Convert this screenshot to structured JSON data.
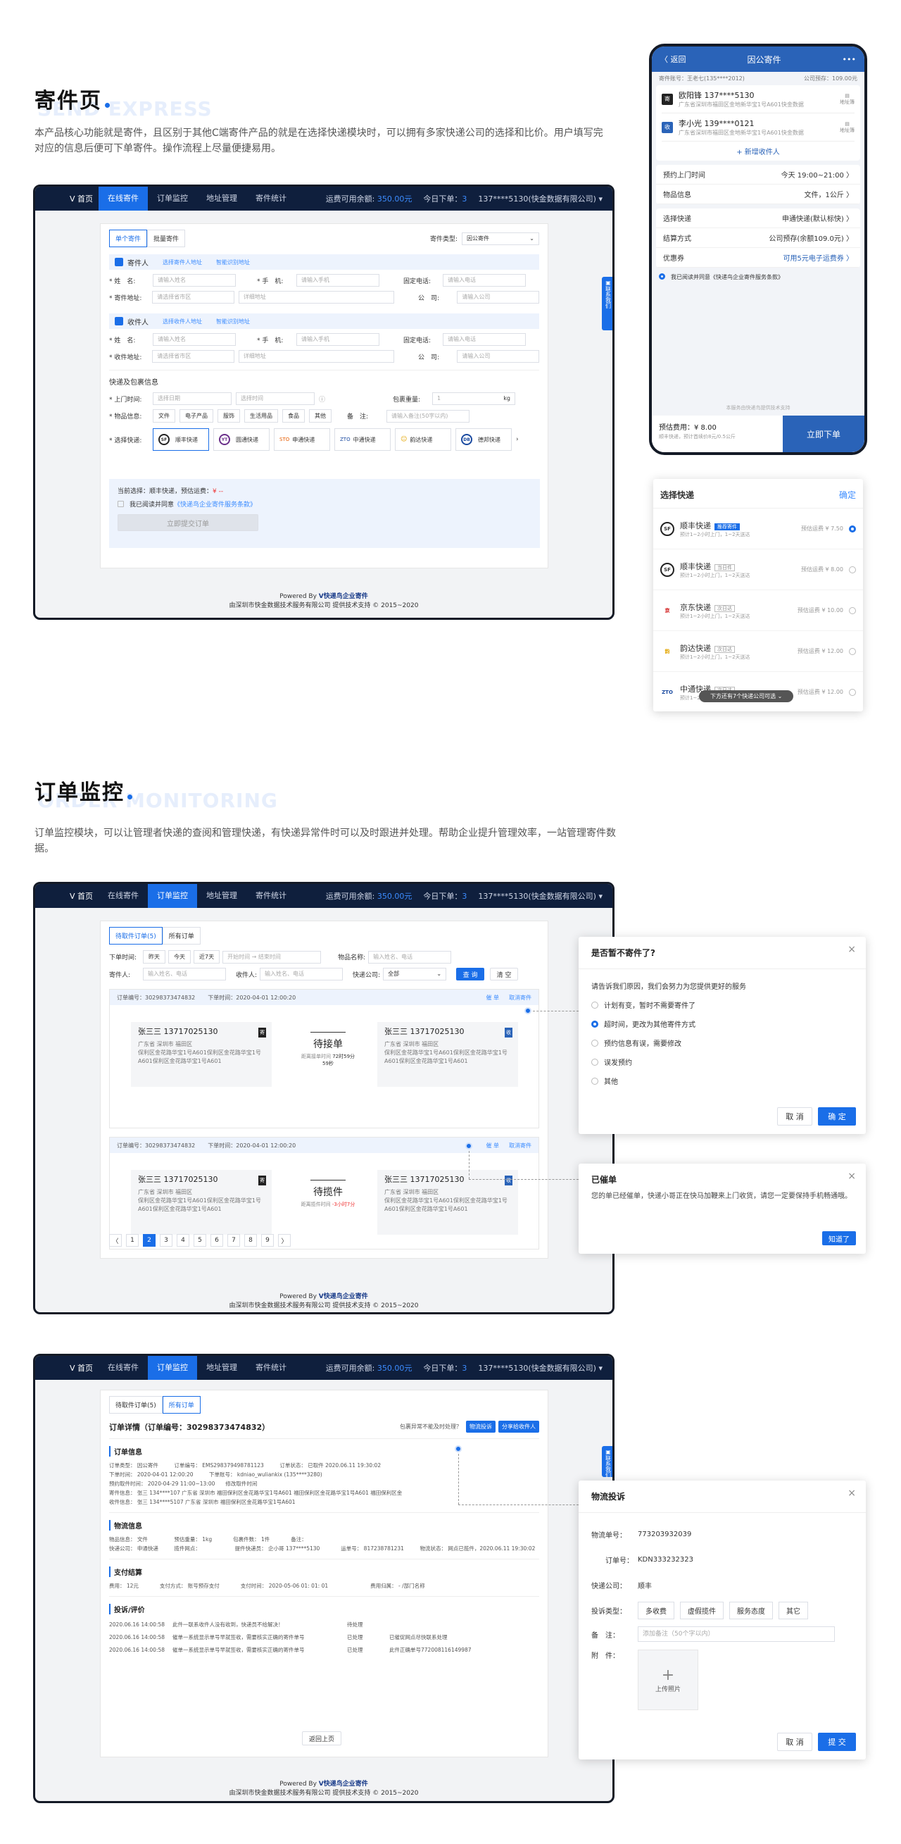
{
  "sec1": {
    "title": "寄件页",
    "en": "SEND EXPRESS",
    "desc": "本产品核心功能就是寄件，且区别于其他C端寄件产品的就是在选择快递模块时，可以拥有多家快递公司的选择和比价。用户填写完对应的信息后便可下单寄件。操作流程上尽量便捷易用。"
  },
  "sec2": {
    "title": "订单监控",
    "en": "ORDER MONITORING",
    "desc": "订单监控模块，可以让管理者快递的查阅和管理快递，有快递异常件时可以及时跟进并处理。帮助企业提升管理效率，一站管理寄件数据。"
  },
  "nav": {
    "logo": "首页",
    "items": [
      "在线寄件",
      "订单监控",
      "地址管理",
      "寄件统计"
    ],
    "balance_label": "运费可用余额:",
    "balance": "350.00元",
    "today_label": "今日下单：",
    "today": "3",
    "user": "137****5130(快金数据有限公司) ▾"
  },
  "footer": {
    "powered": "Powered By",
    "brand": "V快递鸟企业寄件",
    "copyright": "由深圳市快金数据技术服务有限公司 提供技术支持 © 2015~2020"
  },
  "send": {
    "tabs": [
      "单个寄件",
      "批量寄件"
    ],
    "type_label": "寄件类型:",
    "type_value": "因公寄件",
    "sender_title": "寄件人",
    "sender_link1": "选择寄件人地址",
    "sender_link2": "智能识别地址",
    "receiver_title": "收件人",
    "receiver_link1": "选择收件人地址",
    "receiver_link2": "智能识别地址",
    "name_label": "* 姓　名:",
    "name_ph": "请输入姓名",
    "phone_label": "* 手　机:",
    "phone_ph": "请输入手机",
    "tel_label": "固定电话:",
    "tel_ph": "请输入电话",
    "addr_label": "* 寄件地址:",
    "addr_ph": "请选择省市区",
    "addr_detail_ph": "详细地址",
    "company_label": "公　司:",
    "company_ph": "请输入公司",
    "recv_addr_label": "* 收件地址:",
    "pkg_title": "快递及包裹信息",
    "pickup_label": "* 上门时间:",
    "date_ph": "选择日期",
    "time_ph": "选择时间",
    "weight_label": "包裹重量:",
    "weight_val": "1",
    "weight_unit": "kg",
    "goods_label": "* 物品信息:",
    "goods": [
      "文件",
      "电子产品",
      "服饰",
      "生活用品",
      "食品",
      "其他"
    ],
    "remark_label": "备　注:",
    "remark_ph": "请输入备注(50字以内)",
    "express_label": "* 选择快递:",
    "express": [
      "顺丰快递",
      "圆通快递",
      "申通快递",
      "中通快递",
      "韵达快递",
      "德邦快递"
    ],
    "current": "当前选择：顺丰快递，预估运费：",
    "current_price": "¥ --",
    "agree": "我已阅读并同意",
    "agree_link": "《快递鸟企业寄件服务条款》",
    "submit": "立即提交订单",
    "contact": "联系我们"
  },
  "phone": {
    "back": "〈 返回",
    "title": "因公寄件",
    "more": "•••",
    "account": "寄件账号：王老七(135****2012)",
    "quota": "公司预存：109.00元",
    "sender_name": "欧阳锋 137****5130",
    "sender_addr": "广东省深圳市福田区金地新华宝1号A601快金数据",
    "receiver_name": "李小光 139****0121",
    "receiver_addr": "广东省深圳市福田区金地新华宝1号A601快金数据",
    "book": "地址簿",
    "add_receiver": "+ 新增收件人",
    "rows": [
      {
        "k": "预约上门时间",
        "v": "今天 19:00~21:00 〉"
      },
      {
        "k": "物品信息",
        "v": "文件，1公斤 〉"
      },
      {
        "k": "选择快递",
        "v": "申通快递(默认标快) 〉"
      },
      {
        "k": "结算方式",
        "v": "公司预存(余额109.0元) 〉"
      },
      {
        "k": "优惠券",
        "v": "可用5元电子运费券 〉"
      }
    ],
    "agree": "我已阅读并同意《快递鸟企业寄件服务条款》",
    "note": "本服务由快递鸟提供技术支持",
    "fee_label": "预估费用：¥ 8.00",
    "fee_note": "顺丰快递，预计首续价8元/0.5公斤",
    "order": "立即下单"
  },
  "select": {
    "title": "选择快递",
    "confirm": "确定",
    "items": [
      {
        "logo": "SF",
        "name": "顺丰快递",
        "tag": "推荐寄件",
        "sub": "预计1~2小时上门，1~2天送达",
        "price": "预估运费 ¥ 7.50"
      },
      {
        "logo": "SF",
        "name": "顺丰快递",
        "tag": "当日件",
        "sub": "预计1~2小时上门，1~2天送达",
        "price": "预估运费 ¥ 8.00"
      },
      {
        "logo": "京",
        "name": "京东快递",
        "tag": "次日达",
        "sub": "预计1~2小时上门，1~2天送达",
        "price": "预估运费 ¥ 10.00"
      },
      {
        "logo": "韵",
        "name": "韵达快递",
        "tag": "次日达",
        "sub": "预计1~2小时上门，1~2天送达",
        "price": "预估运费 ¥ 12.00"
      },
      {
        "logo": "ZTO",
        "name": "中通快递",
        "tag": "次日达",
        "sub": "预计1~2小时上门，1~2天送达",
        "price": "预估运费 ¥ 12.00"
      }
    ],
    "more": "下方还有7个快递公司可选 ⌄"
  },
  "monitor": {
    "tabs": [
      "待取件订单(5)",
      "所有订单"
    ],
    "time_label": "下单时间:",
    "time_opts": [
      "昨天",
      "今天",
      "近7天"
    ],
    "start_ph": "开始时间",
    "end_ph": "结束时间",
    "goods_label": "物品名称:",
    "goods_ph": "输入姓名、电话",
    "sender_label": "寄件人:",
    "sender_ph": "输入姓名、电话",
    "receiver_label": "收件人:",
    "receiver_ph": "输入姓名、电话",
    "company_label": "快递公司:",
    "company_val": "全部",
    "search": "查 询",
    "clear": "清 空",
    "orders": [
      {
        "no": "订单编号：30298373474832",
        "time": "下单时间：2020-04-01 12:00:20",
        "act1": "催 单",
        "act2": "取消寄件",
        "status": "待接单",
        "status_sub": "距离接单时间",
        "countdown": "72时59分59秒",
        "s_name": "张三三  13717025130",
        "r_name": "张三三  13717025130",
        "area": "广东省 深圳市 福田区",
        "street": "保利区金花路华宝1号A601保利区金花路华宝1号A601保利区金花路华宝1号A601"
      },
      {
        "no": "订单编号：30298373474832",
        "time": "下单时间：2020-04-01 12:00:20",
        "act1": "催 单",
        "act2": "取消寄件",
        "status": "待揽件",
        "status_sub": "距离揽件时间",
        "countdown": "-3小时7分",
        "s_name": "张三三  13717025130",
        "r_name": "张三三  13717025130",
        "area": "广东省 深圳市 福田区",
        "street": "保利区金花路华宝1号A601保利区金花路华宝1号A601保利区金花路华宝1号A601"
      }
    ],
    "pages": [
      "〈",
      "1",
      "2",
      "3",
      "4",
      "5",
      "6",
      "7",
      "8",
      "9",
      "〉"
    ]
  },
  "cancel_modal": {
    "title": "是否暂不寄件了?",
    "tip": "请告诉我们原因，我们会努力为您提供更好的服务",
    "options": [
      "计划有变，暂时不需要寄件了",
      "超时间，更改为其他寄件方式",
      "预约信息有误，需要修改",
      "误发预约",
      "其他"
    ],
    "cancel": "取 消",
    "ok": "确 定"
  },
  "urge_modal": {
    "title": "已催单",
    "text": "您的单已经催单，快递小哥正在快马加鞭来上门收货，请您一定要保持手机畅通哦。",
    "ok": "知道了"
  },
  "detail": {
    "tabs": [
      "待取件订单(5)",
      "所有订单"
    ],
    "title": "订单详情（订单编号：30298373474832）",
    "ask": "包裹异常不能及时处理？",
    "complain_btn": "物流投诉",
    "share_btn": "分享给收件人",
    "sec_order": "订单信息",
    "order_lines": [
      "订单类型：  因公寄件　　　订单编号：  EMS298379498781123　　　订单状态：  已取件  2020.06.11 19:30:02",
      "下单时间：  2020-04-01 12:00:20　　　下单账号：  kdniao_wuliankix  (135****3280)",
      "预约取件时间：  2020-04-29 11:00~13:00　　修改取件时间",
      "寄件信息：  张三 134****107  广东省 深圳市 福田保利区金花路华宝1号A601 福田保利区金花路华宝1号A601 福田保利区金",
      "收件信息：  张三 134****5107  广东省 深圳市 福田保利区金花路华宝1号A601"
    ],
    "sec_logistics": "物流信息",
    "logi_lines": [
      "物品信息：  文件　　　　　预估重量：  1kg　　　　包裹件数：  1件　　　　备注：",
      "快递公司：  申通快递　　　揽件网点：　　　　　　　提件快递员：  企小哥 137****5130　　　　运单号：  817238781231　　　物流状态：  网点已揽件，2020.06.11 19:30:02"
    ],
    "sec_pay": "支付结算",
    "pay_line": "费用：  12元　　　　支付方式：  账号预存支付　　　　支付时间：  2020-05-06  01:  01:  01　　　　　　　　费用归属：  - /部门名称",
    "sec_complain": "投诉/评价",
    "complain_rows": [
      {
        "t": "2020.06.16 14:00:58",
        "c": "此件一联系收件人没有收到，快递员不给解决！",
        "s": "待处理",
        "r": ""
      },
      {
        "t": "2020.06.16 14:00:58",
        "c": "催单一系统显示单号早就签收，需要核实正确的寄件单号",
        "s": "已处理",
        "r": "已催促网点尽快联系处理"
      },
      {
        "t": "2020.06.16 14:00:58",
        "c": "催单一系统显示单号早就签收，需要核实正确的寄件单号",
        "s": "已处理",
        "r": "此件正确单号772008116149987"
      }
    ],
    "back": "返回上页"
  },
  "complain_modal": {
    "title": "物流投诉",
    "waybill_label": "物流单号：",
    "waybill": "773203932039",
    "order_label": "订单号：",
    "order": "KDN333232323",
    "company_label": "快递公司：",
    "company": "顺丰",
    "type_label": "投诉类型：",
    "types": [
      "多收费",
      "虚假揽件",
      "服务态度",
      "其它"
    ],
    "remark_label": "备　注：",
    "remark_ph": "添加备注（50个字以内）",
    "attach_label": "附　件：",
    "upload": "上传照片",
    "cancel": "取 消",
    "submit": "提 交"
  }
}
